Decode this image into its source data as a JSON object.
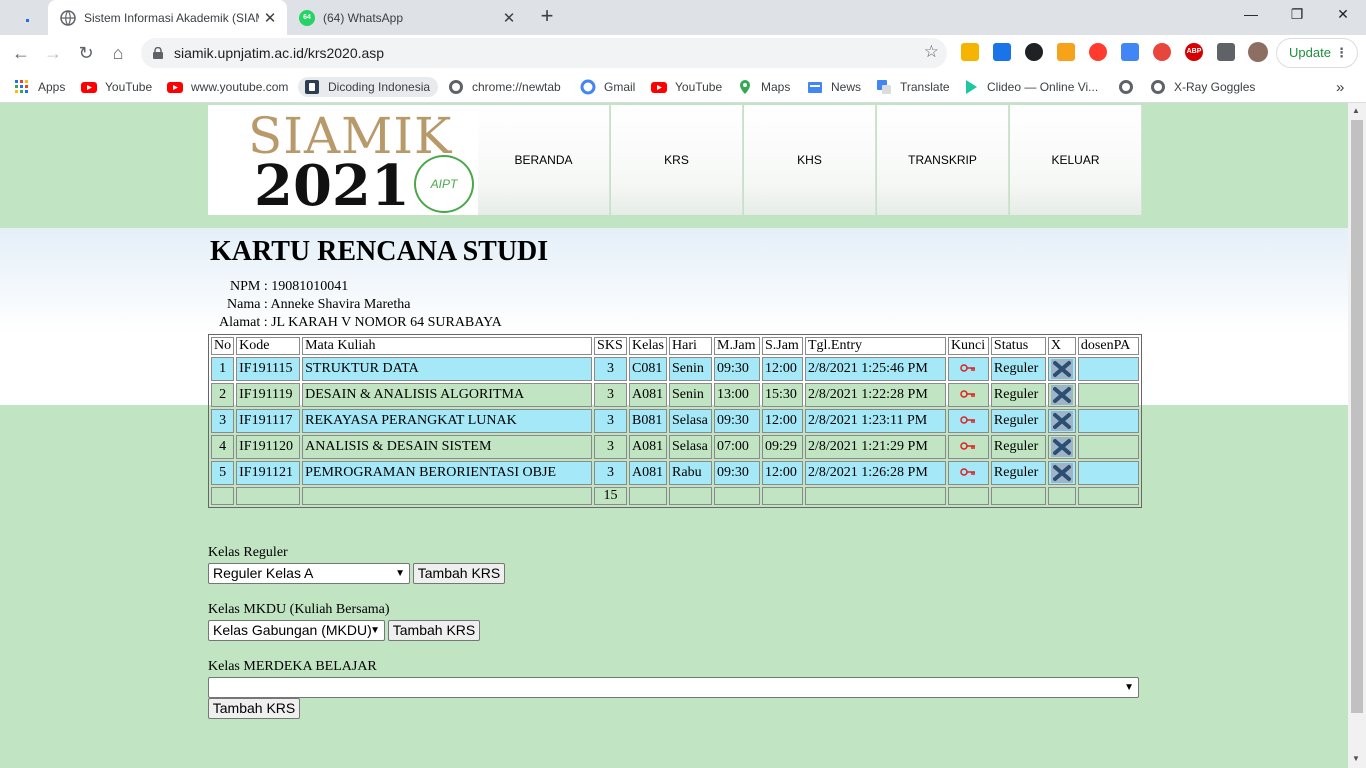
{
  "browser": {
    "tabs": [
      {
        "title": "Sistem Informasi Akademik (SIAMIK)",
        "active": true
      },
      {
        "title": "(64) WhatsApp",
        "badge": "64",
        "active": false
      }
    ],
    "url": "siamik.upnjatim.ac.id/krs2020.asp",
    "update_label": "Update",
    "bookmarks": [
      "Apps",
      "YouTube",
      "www.youtube.com",
      "Dicoding Indonesia",
      "chrome://newtab",
      "Gmail",
      "YouTube",
      "Maps",
      "News",
      "Translate",
      "Clideo — Online Vi...",
      "",
      "X-Ray Goggles"
    ],
    "more_label": "»"
  },
  "site": {
    "logo_text": "SIAMIK",
    "logo_year": "2021",
    "logo_seal": "AIPT",
    "menu": [
      "BERANDA",
      "KRS",
      "KHS",
      "TRANSKRIP",
      "KELUAR"
    ]
  },
  "page": {
    "heading": "KARTU RENCANA STUDI",
    "npm_line": "NPM : 19081010041",
    "nama_line": "Nama : Anneke Shavira Maretha",
    "alamat_line": "Alamat : JL KARAH V NOMOR 64 SURABAYA"
  },
  "table": {
    "headers": [
      "No",
      "Kode",
      "Mata Kuliah",
      "SKS",
      "Kelas",
      "Hari",
      "M.Jam",
      "S.Jam",
      "Tgl.Entry",
      "Kunci",
      "Status",
      "X",
      "dosenPA"
    ],
    "rows": [
      {
        "no": "1",
        "kode": "IF191115",
        "mk": "STRUKTUR DATA",
        "sks": "3",
        "kelas": "C081",
        "hari": "Senin",
        "mjam": "09:30",
        "sjam": "12:00",
        "tgl": "2/8/2021 1:25:46 PM",
        "status": "Reguler",
        "dosen": ""
      },
      {
        "no": "2",
        "kode": "IF191119",
        "mk": "DESAIN & ANALISIS ALGORITMA",
        "sks": "3",
        "kelas": "A081",
        "hari": "Senin",
        "mjam": "13:00",
        "sjam": "15:30",
        "tgl": "2/8/2021 1:22:28 PM",
        "status": "Reguler",
        "dosen": ""
      },
      {
        "no": "3",
        "kode": "IF191117",
        "mk": "REKAYASA PERANGKAT LUNAK",
        "sks": "3",
        "kelas": "B081",
        "hari": "Selasa",
        "mjam": "09:30",
        "sjam": "12:00",
        "tgl": "2/8/2021 1:23:11 PM",
        "status": "Reguler",
        "dosen": ""
      },
      {
        "no": "4",
        "kode": "IF191120",
        "mk": "ANALISIS & DESAIN SISTEM",
        "sks": "3",
        "kelas": "A081",
        "hari": "Selasa",
        "mjam": "07:00",
        "sjam": "09:29",
        "tgl": "2/8/2021 1:21:29 PM",
        "status": "Reguler",
        "dosen": ""
      },
      {
        "no": "5",
        "kode": "IF191121",
        "mk": "PEMROGRAMAN BERORIENTASI OBJE",
        "sks": "3",
        "kelas": "A081",
        "hari": "Rabu",
        "mjam": "09:30",
        "sjam": "12:00",
        "tgl": "2/8/2021 1:26:28 PM",
        "status": "Reguler",
        "dosen": ""
      }
    ],
    "total_sks": "15"
  },
  "forms": {
    "reguler": {
      "label": "Kelas Reguler",
      "selected": "Reguler Kelas A",
      "button": "Tambah KRS"
    },
    "mkdu": {
      "label": "Kelas MKDU (Kuliah Bersama)",
      "selected": "Kelas Gabungan (MKDU)",
      "button": "Tambah KRS"
    },
    "merdeka": {
      "label": "Kelas MERDEKA BELAJAR",
      "selected": "",
      "button": "Tambah KRS"
    }
  },
  "colors": {
    "page_bg": "#c1e4c3",
    "row_blue": "#a5e8f7",
    "accent": "#1a73e8"
  }
}
